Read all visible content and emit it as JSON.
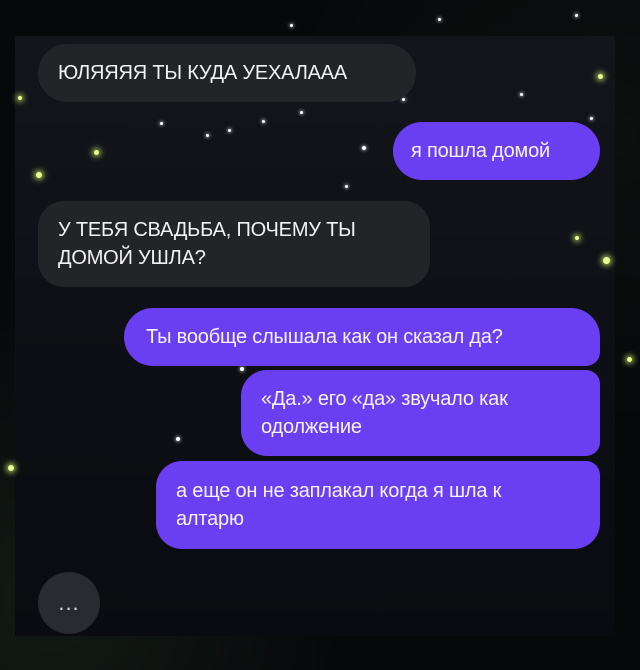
{
  "chat": {
    "messages": [
      {
        "sender": "them",
        "text": "ЮЛЯЯЯЯ ТЫ КУДА УЕХАЛААА"
      },
      {
        "sender": "me",
        "text": "я пошла домой"
      },
      {
        "sender": "them",
        "text": "У ТЕБЯ СВАДЬБА, ПОЧЕМУ ТЫ\nДОМОЙ УШЛА?"
      },
      {
        "sender": "me",
        "text": "Ты вообще слышала как он сказал да?"
      },
      {
        "sender": "me",
        "text": "«Да.» его «да» звучало как\nодолжение"
      },
      {
        "sender": "me",
        "text": "а еще он не заплакал когда я шла к\nалтарю"
      }
    ],
    "typing_indicator": "..."
  },
  "colors": {
    "background": "#07080a",
    "incoming_bubble": "#232428",
    "outgoing_bubble": "#6a3ff2",
    "firefly": "#e8ff8a"
  }
}
